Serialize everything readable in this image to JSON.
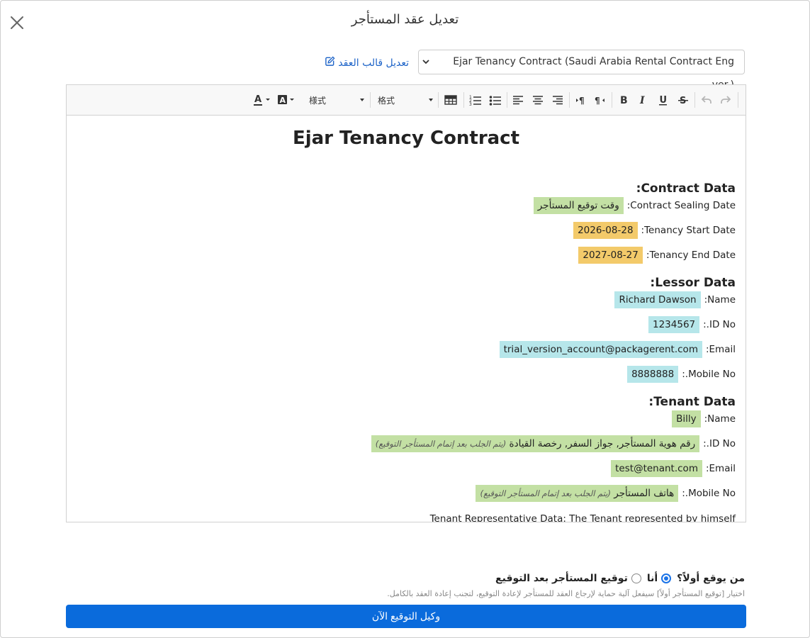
{
  "modal": {
    "title": "تعديل عقد المستأجر"
  },
  "template": {
    "selected": "Ejar Tenancy Contract (Saudi Arabia Rental Contract Eng ver.)",
    "edit_link": "تعديل قالب العقد"
  },
  "toolbar": {
    "styles_label": "様式",
    "format_label": "格式"
  },
  "document": {
    "title": "Ejar Tenancy Contract",
    "contract_section": {
      "heading": "Contract Data:",
      "sealing_date_label": "Contract Sealing Date:",
      "sealing_date_value": "وقت توقيع المستأجر",
      "start_label": "Tenancy Start Date:",
      "start_value": "2026-08-28",
      "end_label": "Tenancy End Date:",
      "end_value": "2027-08-27"
    },
    "lessor_section": {
      "heading": "Lessor Data:",
      "name_label": "Name:",
      "name_value": "Richard Dawson",
      "id_label": "ID No.:",
      "id_value": "1234567",
      "email_label": "Email:",
      "email_value": "trial_version_account@packagerent.com",
      "mobile_label": "Mobile No.:",
      "mobile_value": "8888888"
    },
    "tenant_section": {
      "heading": "Tenant Data:",
      "name_label": "Name:",
      "name_value": "Billy",
      "id_label": "ID No.:",
      "id_value": "رقم هوية المستأجر, جواز السفر, رخصة القيادة",
      "id_hint": "(يتم الجلب بعد إتمام المستأجر التوقيع)",
      "email_label": "Email:",
      "email_value": "test@tenant.com",
      "mobile_label": "Mobile No.:",
      "mobile_value": "هاتف المستأجر",
      "mobile_hint": "(يتم الجلب بعد إتمام المستأجر التوقيع)",
      "representative": "Tenant Representative Data: The Tenant represented by himself"
    }
  },
  "signing": {
    "question": "من يوقع أولاً؟",
    "option_me": "أنا",
    "option_tenant": "توقيع المستأجر بعد التوقيع",
    "selected": "option_me",
    "hint": "اختيار [توقيع المستأجر أولاً] سيفعل آلية حماية لإرجاع العقد للمستأجر لإعادة التوقيع، لتجنب إعادة العقد بالكامل."
  },
  "submit_label": "وكيل التوقيع الآن",
  "colors": {
    "primary": "#0a6bdc",
    "link": "#1e64c8",
    "highlight_green": "#c3e0a4",
    "highlight_orange": "#f3ca6a",
    "highlight_cyan": "#b6e6ea"
  }
}
